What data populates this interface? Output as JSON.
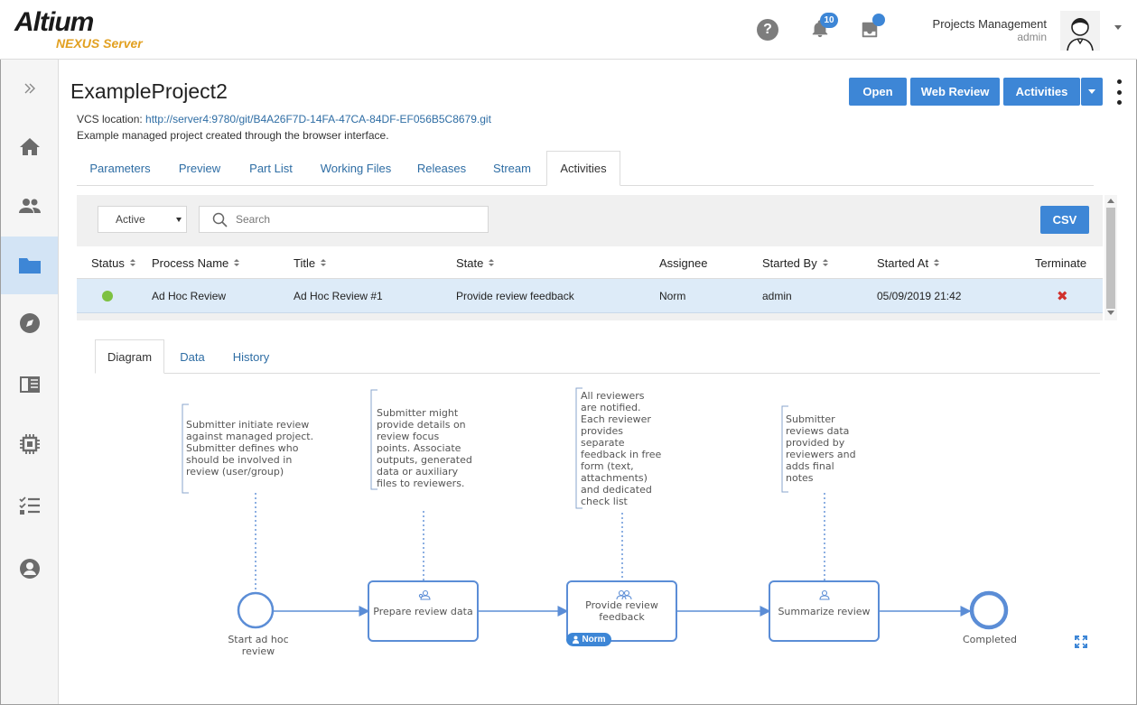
{
  "app": {
    "logo": "Altium",
    "logo_sub": "NEXUS Server"
  },
  "header": {
    "notification_count": "10",
    "user_name": "Projects Management",
    "user_role": "admin"
  },
  "sidebar": {
    "items": [
      {
        "name": "expand",
        "icon": "double-chevron-right-icon"
      },
      {
        "name": "home",
        "icon": "home-icon"
      },
      {
        "name": "users",
        "icon": "users-icon"
      },
      {
        "name": "projects",
        "icon": "folder-icon",
        "active": true
      },
      {
        "name": "explore",
        "icon": "compass-icon"
      },
      {
        "name": "library",
        "icon": "book-icon"
      },
      {
        "name": "components",
        "icon": "chip-icon"
      },
      {
        "name": "tasks",
        "icon": "checklist-icon"
      },
      {
        "name": "account",
        "icon": "account-icon"
      }
    ]
  },
  "project": {
    "title": "ExampleProject2",
    "vcs_label": "VCS location: ",
    "vcs_url": "http://server4:9780/git/B4A26F7D-14FA-47CA-84DF-EF056B5C8679.git",
    "description": "Example managed project created through the browser interface."
  },
  "actions": {
    "open": "Open",
    "web_review": "Web Review",
    "activities": "Activities"
  },
  "tabs": [
    "Parameters",
    "Preview",
    "Part List",
    "Working Files",
    "Releases",
    "Stream",
    "Activities"
  ],
  "active_tab": "Activities",
  "filter": {
    "status_value": "Active",
    "search_placeholder": "Search",
    "csv_label": "CSV"
  },
  "table": {
    "columns": [
      "Status",
      "Process Name",
      "Title",
      "State",
      "Assignee",
      "Started By",
      "Started At",
      "Terminate"
    ],
    "rows": [
      {
        "status": "active",
        "process_name": "Ad Hoc Review",
        "title": "Ad Hoc Review #1",
        "state": "Provide review feedback",
        "assignee": "Norm",
        "started_by": "admin",
        "started_at": "05/09/2019 21:42",
        "terminate_icon": "close-icon"
      }
    ]
  },
  "subtabs": [
    "Diagram",
    "Data",
    "History"
  ],
  "active_subtab": "Diagram",
  "diagram": {
    "annotations": [
      "Submitter initiate review\nagainst managed project.\nSubmitter defines who\nshould be involved in\nreview (user/group)",
      "Submitter might\nprovide details on\nreview focus\npoints. Associate\noutputs, generated\ndata or auxiliary\nfiles to reviewers.",
      "All reviewers\nare notified.\nEach reviewer\nprovides\nseparate\nfeedback in free\nform (text,\nattachments)\nand dedicated\ncheck list",
      "Submitter\nreviews data\nprovided by\nreviewers and\nadds final\nnotes"
    ],
    "start_label": "Start ad hoc\nreview",
    "tasks": [
      "Prepare review data",
      "Provide review\nfeedback",
      "Summarize review"
    ],
    "end_label": "Completed",
    "assignee_badge": "Norm",
    "colors": {
      "flow": "#5b8dd6",
      "active_badge": "#3d86d6"
    }
  }
}
